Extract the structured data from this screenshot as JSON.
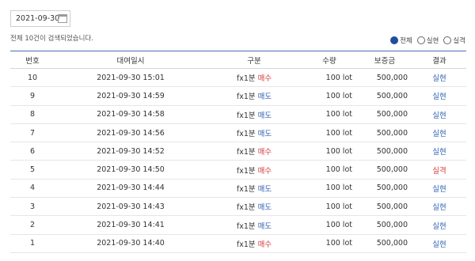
{
  "date_filter": {
    "value": "2021-09-30"
  },
  "summary_text": "전체 10건이 검색되었습니다.",
  "filters": [
    {
      "label": "전체",
      "checked": true
    },
    {
      "label": "실현",
      "checked": false
    },
    {
      "label": "실격",
      "checked": false
    }
  ],
  "table": {
    "headers": [
      "번호",
      "대여일시",
      "구분",
      "수량",
      "보증금",
      "결과"
    ],
    "rows": [
      {
        "no": "10",
        "datetime": "2021-09-30 15:01",
        "type": "fx1분",
        "side": "매수",
        "qty": "100 lot",
        "deposit": "500,000",
        "result": "실현"
      },
      {
        "no": "9",
        "datetime": "2021-09-30 14:59",
        "type": "fx1분",
        "side": "매도",
        "qty": "100 lot",
        "deposit": "500,000",
        "result": "실현"
      },
      {
        "no": "8",
        "datetime": "2021-09-30 14:58",
        "type": "fx1분",
        "side": "매도",
        "qty": "100 lot",
        "deposit": "500,000",
        "result": "실현"
      },
      {
        "no": "7",
        "datetime": "2021-09-30 14:56",
        "type": "fx1분",
        "side": "매도",
        "qty": "100 lot",
        "deposit": "500,000",
        "result": "실현"
      },
      {
        "no": "6",
        "datetime": "2021-09-30 14:52",
        "type": "fx1분",
        "side": "매수",
        "qty": "100 lot",
        "deposit": "500,000",
        "result": "실현"
      },
      {
        "no": "5",
        "datetime": "2021-09-30 14:50",
        "type": "fx1분",
        "side": "매수",
        "qty": "100 lot",
        "deposit": "500,000",
        "result": "실격"
      },
      {
        "no": "4",
        "datetime": "2021-09-30 14:44",
        "type": "fx1분",
        "side": "매도",
        "qty": "100 lot",
        "deposit": "500,000",
        "result": "실현"
      },
      {
        "no": "3",
        "datetime": "2021-09-30 14:43",
        "type": "fx1분",
        "side": "매도",
        "qty": "100 lot",
        "deposit": "500,000",
        "result": "실현"
      },
      {
        "no": "2",
        "datetime": "2021-09-30 14:41",
        "type": "fx1분",
        "side": "매도",
        "qty": "100 lot",
        "deposit": "500,000",
        "result": "실현"
      },
      {
        "no": "1",
        "datetime": "2021-09-30 14:40",
        "type": "fx1분",
        "side": "매수",
        "qty": "100 lot",
        "deposit": "500,000",
        "result": "실현"
      }
    ]
  }
}
